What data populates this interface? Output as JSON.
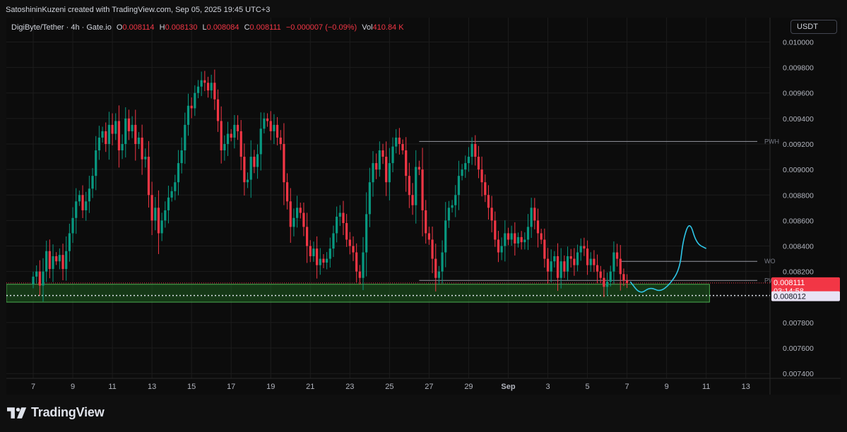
{
  "header": {
    "attribution": "SatoshininKuzeni created with TradingView.com, Sep 05, 2025 19:45 UTC+3"
  },
  "legend": {
    "symbol": "DigiByte/Tether · 4h · Gate.io",
    "o_label": "O",
    "o_value": "0.008114",
    "h_label": "H",
    "h_value": "0.008130",
    "l_label": "L",
    "l_value": "0.008084",
    "c_label": "C",
    "c_value": "0.008111",
    "change": "−0.000007 (−0.09%)",
    "vol_label": "Vol",
    "vol_value": "410.84 K"
  },
  "currency_button": "USDT",
  "brand": {
    "name": "TradingView"
  },
  "colors": {
    "up": "#089981",
    "down": "#f23645",
    "background": "#0c0c0c",
    "zone": "#1d5c1f",
    "drawing": "#2ec5e6"
  },
  "chart_data": {
    "type": "candlestick",
    "ylim": [
      0.00739,
      0.01008
    ],
    "yticks": [
      "0.010000",
      "0.009800",
      "0.009600",
      "0.009400",
      "0.009200",
      "0.009000",
      "0.008800",
      "0.008600",
      "0.008400",
      "0.008200",
      "0.008000",
      "0.007800",
      "0.007600",
      "0.007400"
    ],
    "xticks": [
      {
        "label": "7",
        "t": 0
      },
      {
        "label": "9",
        "t": 12
      },
      {
        "label": "11",
        "t": 24
      },
      {
        "label": "13",
        "t": 36
      },
      {
        "label": "15",
        "t": 48
      },
      {
        "label": "17",
        "t": 60
      },
      {
        "label": "19",
        "t": 72
      },
      {
        "label": "21",
        "t": 84
      },
      {
        "label": "23",
        "t": 96
      },
      {
        "label": "25",
        "t": 108
      },
      {
        "label": "27",
        "t": 120
      },
      {
        "label": "29",
        "t": 132
      },
      {
        "label": "Sep",
        "t": 144
      },
      {
        "label": "3",
        "t": 156
      },
      {
        "label": "5",
        "t": 168
      },
      {
        "label": "7",
        "t": 180
      },
      {
        "label": "9",
        "t": 192
      },
      {
        "label": "11",
        "t": 204
      },
      {
        "label": "13",
        "t": 216
      }
    ],
    "closes": [
      0.00816,
      0.0082,
      0.00809,
      0.0082,
      0.00836,
      0.00822,
      0.00832,
      0.00828,
      0.00833,
      0.00822,
      0.00836,
      0.0085,
      0.00862,
      0.00875,
      0.0088,
      0.00868,
      0.00875,
      0.00885,
      0.00895,
      0.00915,
      0.00925,
      0.0093,
      0.0092,
      0.00935,
      0.00928,
      0.00938,
      0.00915,
      0.0092,
      0.0094,
      0.0093,
      0.00935,
      0.0092,
      0.00925,
      0.00908,
      0.0091,
      0.0088,
      0.0086,
      0.0087,
      0.0085,
      0.0086,
      0.00868,
      0.00878,
      0.00883,
      0.0089,
      0.00905,
      0.00915,
      0.00935,
      0.0095,
      0.00948,
      0.0096,
      0.00965,
      0.0097,
      0.00968,
      0.00962,
      0.00968,
      0.00955,
      0.00938,
      0.00915,
      0.0092,
      0.00928,
      0.00925,
      0.00935,
      0.0093,
      0.0091,
      0.0089,
      0.00892,
      0.0091,
      0.00902,
      0.00912,
      0.00932,
      0.0094,
      0.00938,
      0.0093,
      0.00935,
      0.00925,
      0.0092,
      0.0089,
      0.00875,
      0.00855,
      0.00862,
      0.0087,
      0.00866,
      0.00855,
      0.0084,
      0.00832,
      0.00838,
      0.00825,
      0.0083,
      0.00827,
      0.0083,
      0.00838,
      0.0085,
      0.00863,
      0.00866,
      0.00858,
      0.00845,
      0.0084,
      0.00835,
      0.0082,
      0.00815,
      0.00835,
      0.00865,
      0.0089,
      0.00905,
      0.009,
      0.00915,
      0.0091,
      0.0089,
      0.00905,
      0.00918,
      0.00925,
      0.0092,
      0.00915,
      0.00895,
      0.0088,
      0.00872,
      0.00902,
      0.009,
      0.00868,
      0.0085,
      0.00845,
      0.0083,
      0.00815,
      0.0082,
      0.00835,
      0.0086,
      0.0087,
      0.00872,
      0.0088,
      0.00895,
      0.009,
      0.00905,
      0.0091,
      0.0092,
      0.0091,
      0.009,
      0.0089,
      0.0088,
      0.0087,
      0.0086,
      0.00845,
      0.00835,
      0.0084,
      0.0085,
      0.00845,
      0.0085,
      0.00842,
      0.00847,
      0.00843,
      0.00845,
      0.00855,
      0.0087,
      0.0086,
      0.0085,
      0.00845,
      0.0083,
      0.0082,
      0.00828,
      0.00832,
      0.00815,
      0.00828,
      0.0082,
      0.00832,
      0.0083,
      0.00825,
      0.00835,
      0.0084,
      0.00838,
      0.00825,
      0.0083,
      0.00825,
      0.0082,
      0.00815,
      0.00808,
      0.00812,
      0.0082,
      0.00835,
      0.0083,
      0.00818,
      0.00813,
      0.00811
    ],
    "levels": [
      {
        "label": "PWH",
        "value": 0.00922
      },
      {
        "label": "WO",
        "value": 0.00828
      },
      {
        "label": "PWL",
        "value": 0.00813
      }
    ],
    "zone": {
      "top": 0.0081,
      "bottom": 0.00796
    },
    "dotted_level": 0.008012,
    "price_tags": {
      "last": "0.008111",
      "countdown": "03:14:58",
      "lower": "0.008012"
    },
    "projection": [
      {
        "t": 181,
        "v": 0.00812
      },
      {
        "t": 184,
        "v": 0.00802
      },
      {
        "t": 187,
        "v": 0.00808
      },
      {
        "t": 190,
        "v": 0.00804
      },
      {
        "t": 193,
        "v": 0.0081
      },
      {
        "t": 196,
        "v": 0.00822
      },
      {
        "t": 197,
        "v": 0.00845
      },
      {
        "t": 199,
        "v": 0.0086
      },
      {
        "t": 201,
        "v": 0.00842
      },
      {
        "t": 204,
        "v": 0.00838
      }
    ]
  }
}
